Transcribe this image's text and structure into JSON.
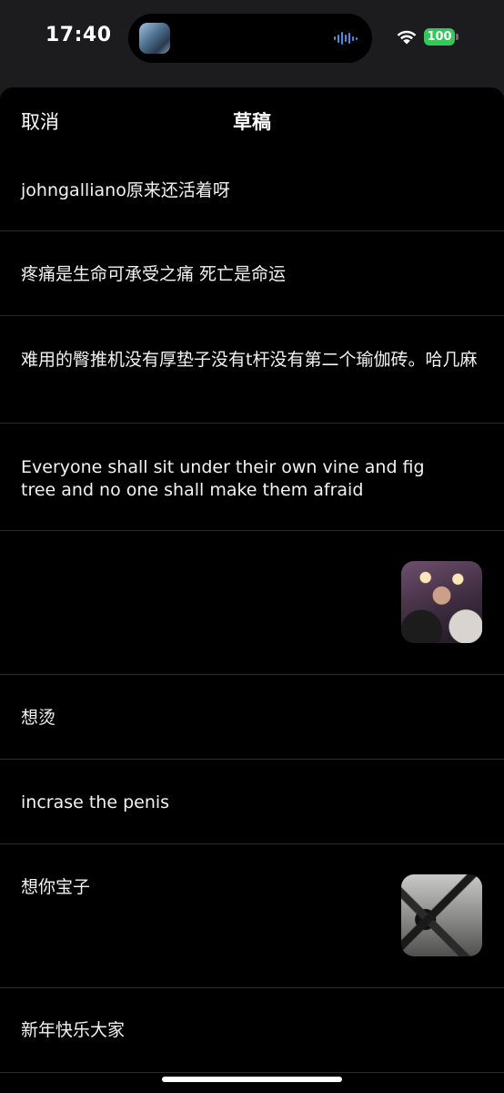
{
  "status_bar": {
    "time": "17:40",
    "battery": "100",
    "battery_color": "#34c759",
    "icons": [
      "now-playing-thumbnail",
      "waveform-icon",
      "wifi-icon",
      "battery-icon"
    ]
  },
  "nav": {
    "cancel_label": "取消",
    "title": "草稿"
  },
  "drafts": [
    {
      "text": "johngalliano原来还活着呀",
      "has_image": false
    },
    {
      "text": "疼痛是生命可承受之痛 死亡是命运",
      "has_image": false
    },
    {
      "text": "难用的臀推机没有厚垫子没有t杆没有第二个瑜伽砖。哈几麻",
      "has_image": false
    },
    {
      "text": "Everyone shall sit under their own vine and fig tree and no one shall make them afraid",
      "has_image": false
    },
    {
      "text": "",
      "has_image": true,
      "image": "selfie-photo"
    },
    {
      "text": "想烫",
      "has_image": false
    },
    {
      "text": "incrase the penis",
      "has_image": false
    },
    {
      "text": "想你宝子",
      "has_image": true,
      "image": "gym-photo"
    },
    {
      "text": "新年快乐大家",
      "has_image": false
    }
  ]
}
